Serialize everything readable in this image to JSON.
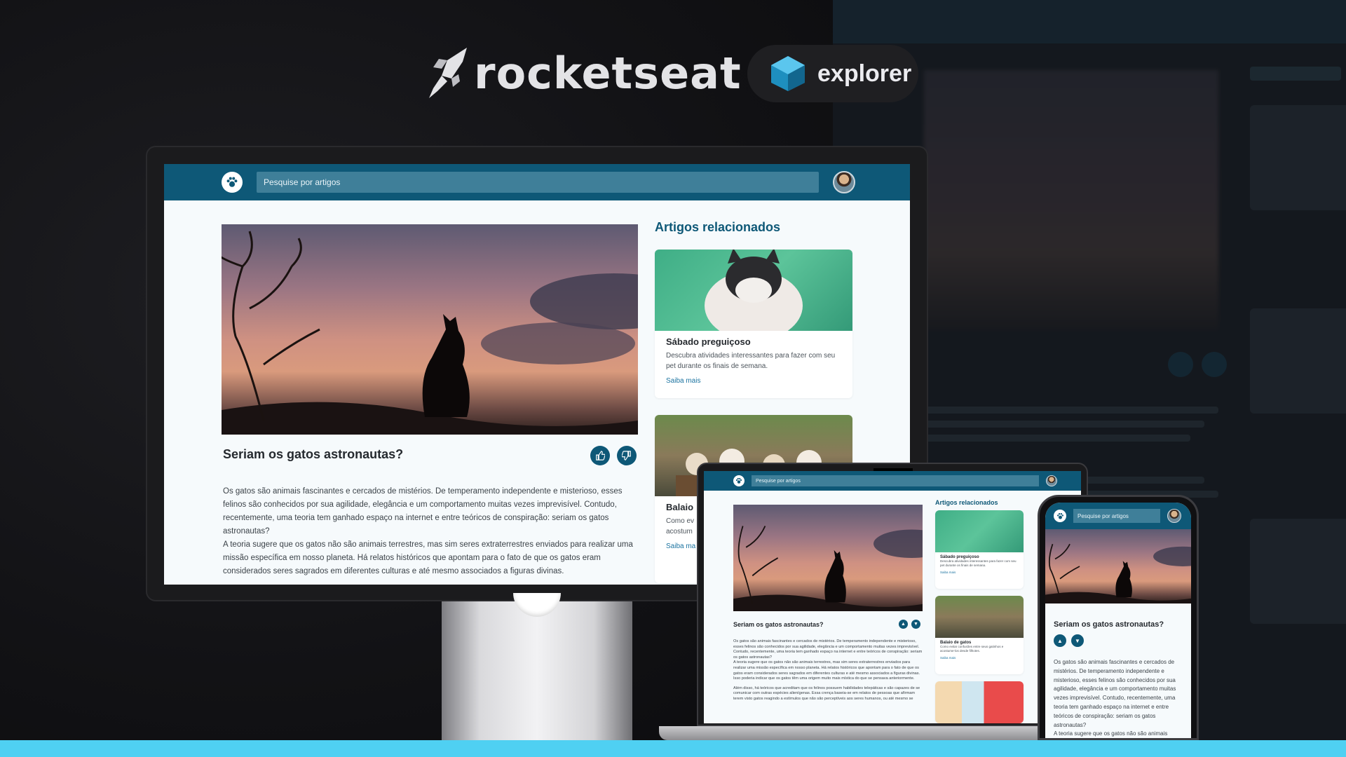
{
  "brand": {
    "name": "rocketseat",
    "product": "explorer"
  },
  "blog": {
    "search_placeholder": "Pesquise por artigos",
    "article": {
      "title": "Seriam os gatos astronautas?",
      "paragraphs": [
        "Os gatos são animais fascinantes e cercados de mistérios. De temperamento independente e misterioso, esses felinos são conhecidos por sua agilidade, elegância e um comportamento muitas vezes imprevisível. Contudo, recentemente, uma teoria tem ganhado espaço na internet e entre teóricos de conspiração: seriam os gatos astronautas?",
        "A teoria sugere que os gatos não são animais terrestres, mas sim seres extraterrestres enviados para realizar uma missão específica em nosso planeta. Há relatos históricos que apontam para o fato de que os gatos eram considerados seres sagrados em diferentes culturas e até mesmo associados a figuras divinas."
      ]
    },
    "related": {
      "heading": "Artigos relacionados",
      "cards": [
        {
          "title": "Sábado preguiçoso",
          "description": "Descubra atividades interessantes para fazer com seu pet durante os finais de semana.",
          "link": "Saiba mais"
        },
        {
          "title": "Balaio de gatos",
          "title_visible_desktop": "Balaio",
          "description": "Como evitar confusões entre seus gatinhos e acostume-los desde filhotes.",
          "description_visible_desktop": "Como ev acostum",
          "link": "Saiba mais",
          "link_visible_desktop": "Saiba ma"
        }
      ]
    },
    "laptop_extra_paragraph": "Além disso, há teóricos que acreditam que os felinos possuem habilidades telepáticas e são capazes de se comunicar com outras espécies alienígenas. Essa crença baseia-se em relatos de pessoas que afirmam terem visto gatos reagindo a estímulos que não são perceptíveis aos seres humanos, ou até mesmo se",
    "laptop_para2_tail": "Isso poderia indicar que os gatos têm uma origem muito mais mística do que se pensava anteriormente."
  },
  "colors": {
    "topbar": "#0e5877",
    "accent": "#1b73a0",
    "stripe": "#4fd0f2",
    "background": "#111114"
  }
}
